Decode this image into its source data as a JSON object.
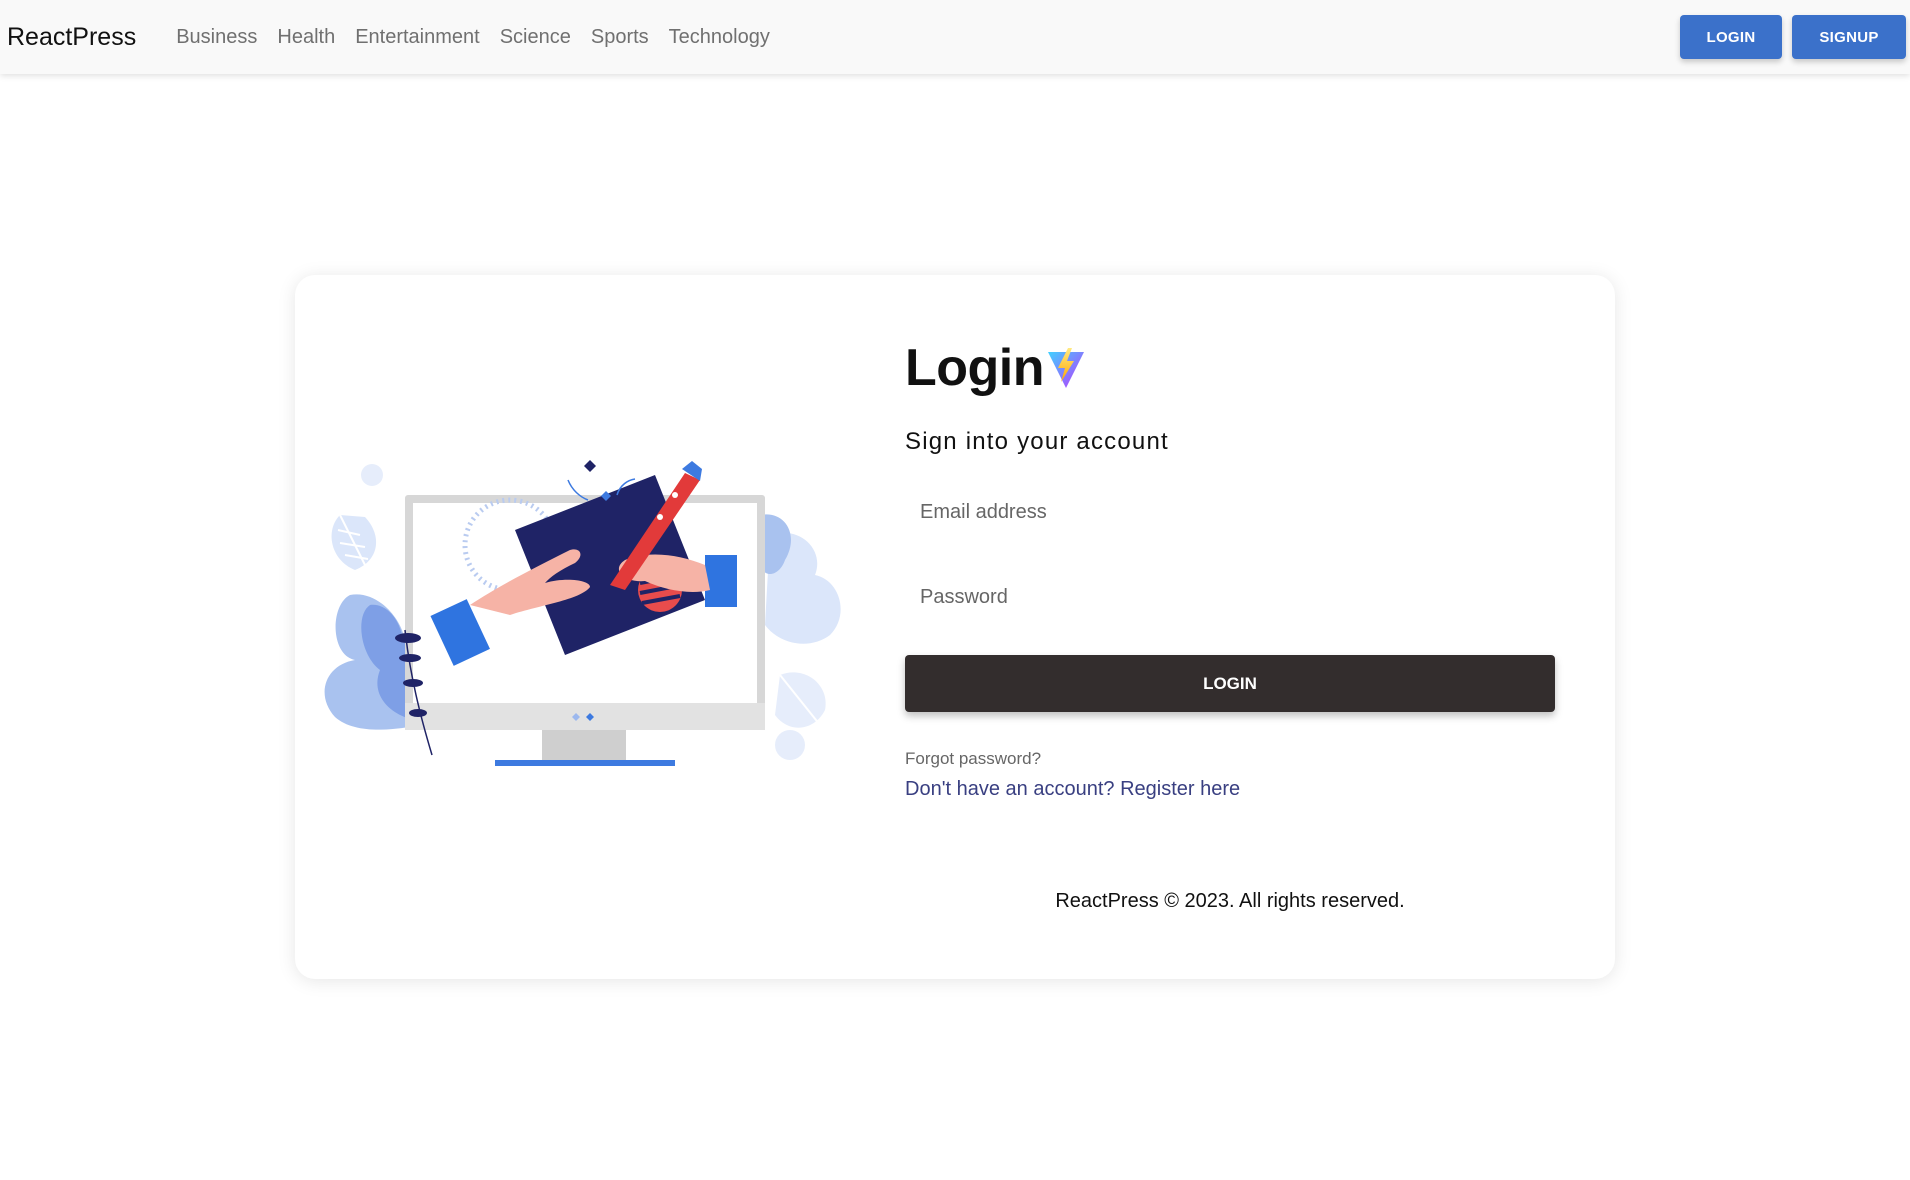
{
  "navbar": {
    "brand": "ReactPress",
    "links": [
      "Business",
      "Health",
      "Entertainment",
      "Science",
      "Sports",
      "Technology"
    ],
    "login_label": "LOGIN",
    "signup_label": "SIGNUP",
    "button_color": "#3b71ca"
  },
  "login_card": {
    "title": "Login",
    "subtitle": "Sign into your account",
    "email_placeholder": "Email address",
    "email_value": "",
    "password_placeholder": "Password",
    "password_value": "",
    "submit_label": "LOGIN",
    "submit_color": "#332d2d",
    "forgot_label": "Forgot password?",
    "register_label": "Don't have an account? Register here",
    "register_color": "#393f81",
    "illustration_icon": "designer-drawing-on-monitor-illustration",
    "logo_icon": "vite-logo-icon"
  },
  "footer": {
    "text": "ReactPress © 2023. All rights reserved."
  }
}
